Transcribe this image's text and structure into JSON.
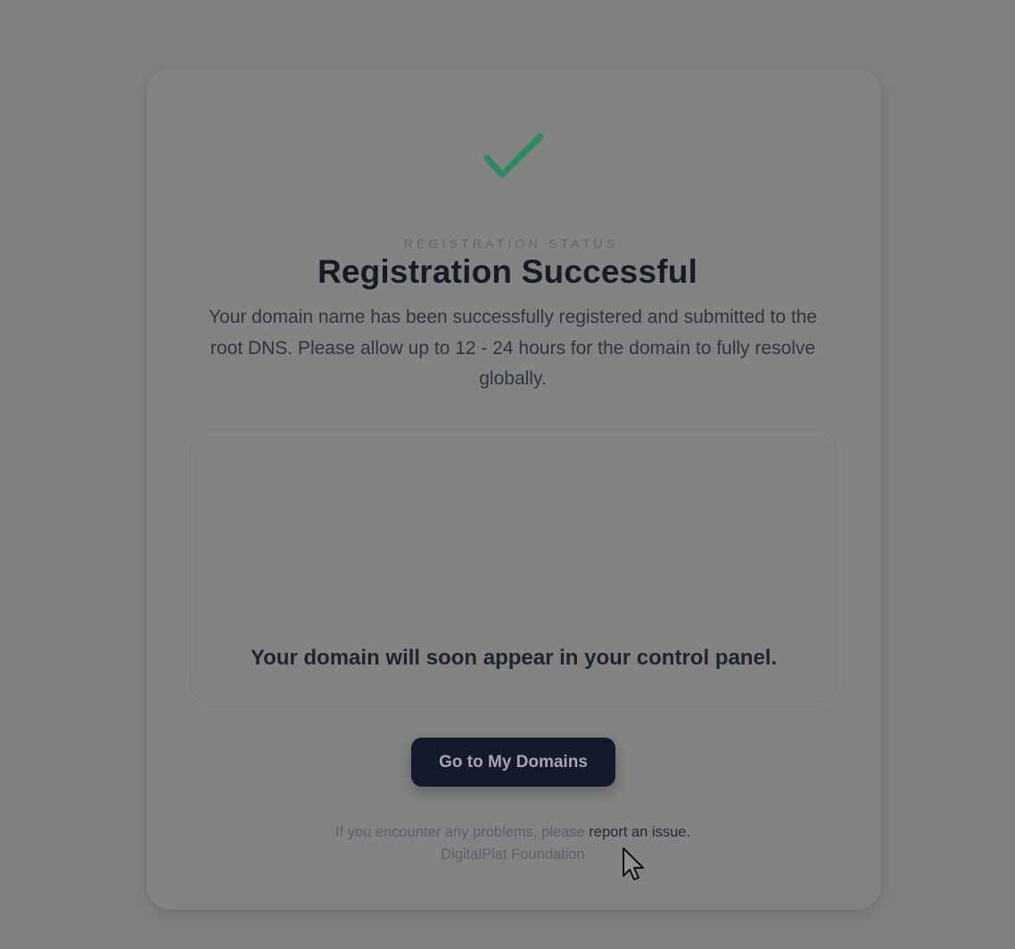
{
  "status": {
    "eyebrow": "REGISTRATION STATUS",
    "title": "Registration Successful",
    "description": "Your domain name has been successfully registered and submitted to the root DNS. Please allow up to 12 - 24 hours for the domain to fully resolve globally.",
    "icon": "check-icon",
    "icon_color": "#2e8a61"
  },
  "panel": {
    "message": "Your domain will soon appear in your control panel."
  },
  "actions": {
    "primary_label": "Go to My Domains"
  },
  "footer": {
    "prefix": "If you encounter any problems, please ",
    "link": "report an issue",
    "suffix": ".",
    "org": "DigitalPlat Foundation"
  },
  "colors": {
    "overlay_bg": "#7f807f",
    "button_bg": "#141a2b",
    "title": "#161b27"
  }
}
